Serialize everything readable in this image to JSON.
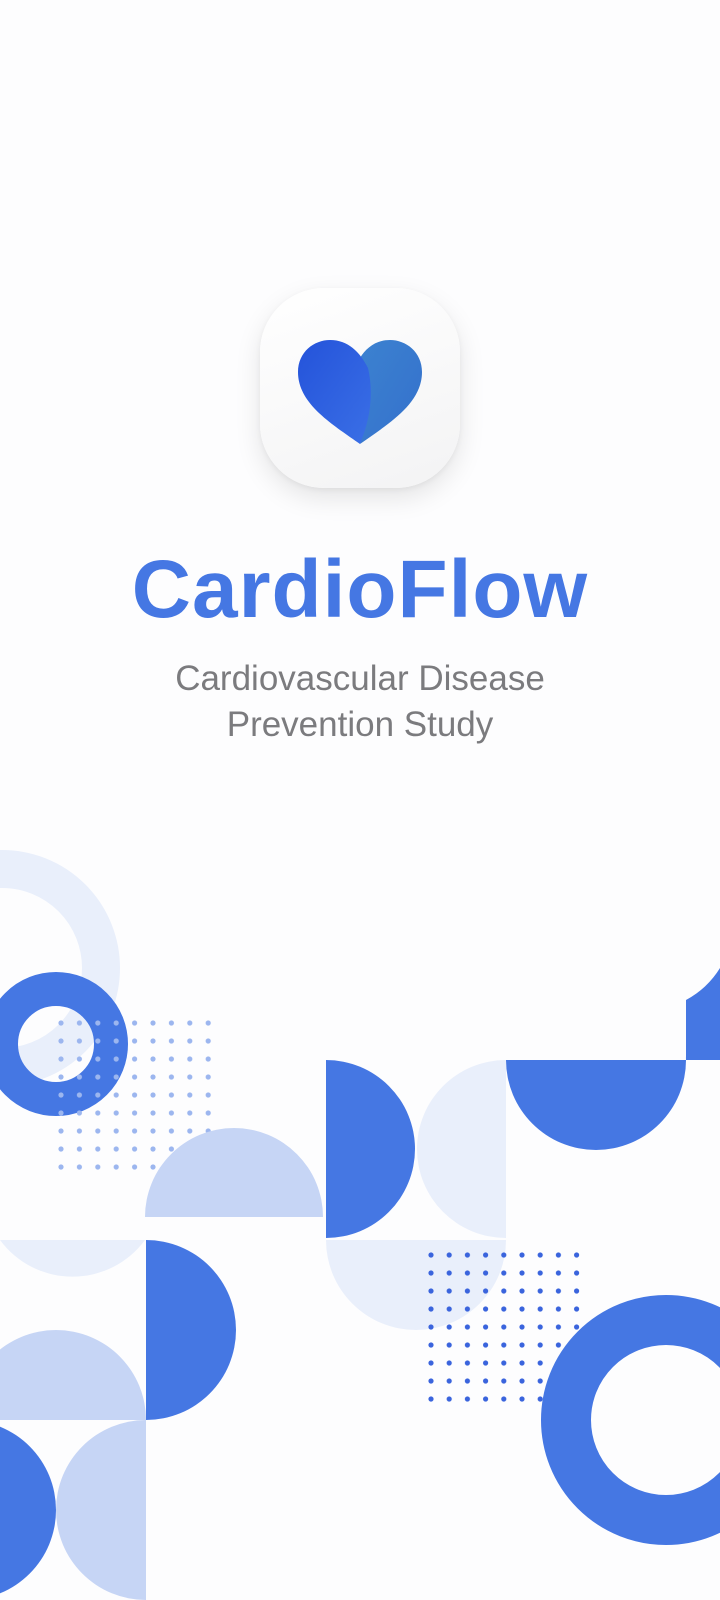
{
  "app": {
    "name": "CardioFlow",
    "subtitle_line1": "Cardiovascular Disease",
    "subtitle_line2": "Prevention Study"
  },
  "icon": {
    "name": "heart-icon"
  },
  "colors": {
    "brand": "#4577e3",
    "brand_light": "#c6d5f5",
    "brand_pale": "#e9effb",
    "subtitle": "#7b7b7e",
    "heart_left": "#2d5fdc",
    "heart_right": "#3b7ccc"
  }
}
